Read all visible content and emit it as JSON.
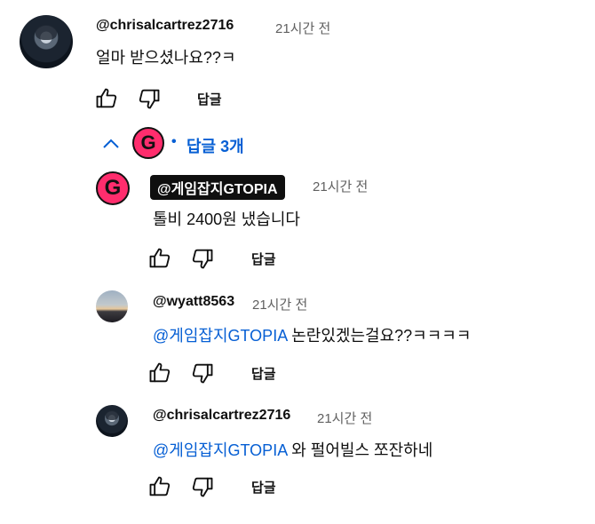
{
  "thread": {
    "comment": {
      "author": "@chrisalcartrez2716",
      "time": "21시간 전",
      "text": "얼마 받으셨나요??ㅋ",
      "reply_label": "답글"
    },
    "replies_toggle": {
      "icon": "chevron-up-icon",
      "avatar_letter": "G",
      "dot": "•",
      "label": "답글 3개"
    },
    "replies": [
      {
        "author": "@게임잡지GTOPIA",
        "time": "21시간 전",
        "text": "톨비 2400원 냈습니다",
        "reply_label": "답글",
        "avatar_letter": "G"
      },
      {
        "author": "@wyatt8563",
        "time": "21시간 전",
        "mention": "@게임잡지GTOPIA",
        "text": "논란있겠는걸요??ㅋㅋㅋㅋ",
        "reply_label": "답글"
      },
      {
        "author": "@chrisalcartrez2716",
        "time": "21시간 전",
        "mention": "@게임잡지GTOPIA",
        "text": "와 펄어빌스 쪼잔하네",
        "reply_label": "답글"
      }
    ]
  },
  "colors": {
    "link": "#065fd4",
    "creator_avatar": "#ff2d6d",
    "meta": "#606060"
  }
}
